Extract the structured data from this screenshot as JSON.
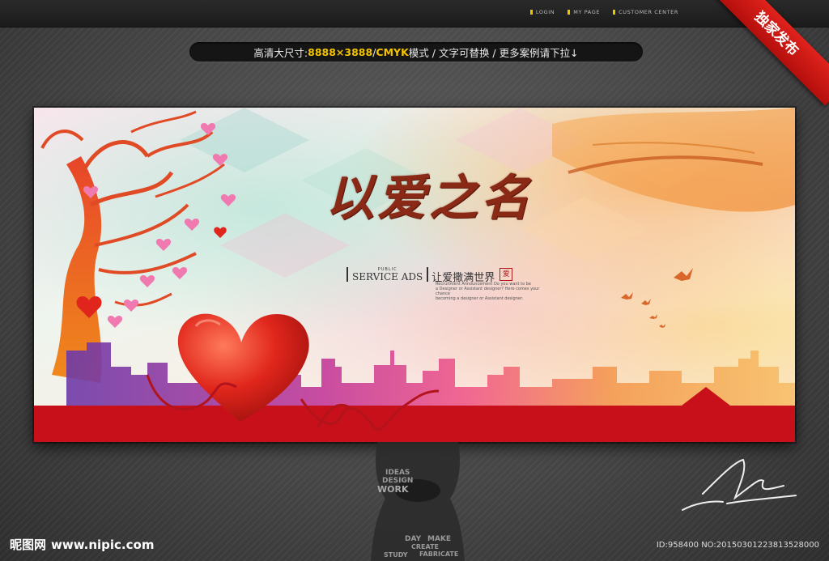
{
  "nav": {
    "items": [
      {
        "label": "LOGIN"
      },
      {
        "label": "MY PAGE"
      },
      {
        "label": "CUSTOMER CENTER"
      }
    ]
  },
  "ribbon": {
    "label": "独家发布"
  },
  "info_bar": {
    "part1": "高清大尺寸:",
    "size": "8888×3888",
    "sep1": " / ",
    "mode": "CMYK",
    "part2": "模式 / 文字可替换 / 更多案例请下拉↓"
  },
  "poster": {
    "title": "以爱之名",
    "public": "PUBLIC",
    "service_ads": "SERVICE ADS",
    "slogan": "让爱撒满世界",
    "seal": "爱",
    "desc_line1": "Recruitment Announcement Do you want to be",
    "desc_line2": "a Designer or Assistant designer? Here comes your chance",
    "desc_line3": "becoming a designer or Assistant designer."
  },
  "portrait_words": [
    "IDEAS",
    "DESIGN",
    "WORK",
    "DAY",
    "MAKE",
    "CREATE",
    "FABRICATE",
    "STUDY"
  ],
  "watermark": {
    "site_cn": "昵图网",
    "site_url": "www.nipic.com",
    "id_line": "ID:958400 NO:20150301223813528000"
  },
  "colors": {
    "accent_yellow": "#f4c400",
    "ribbon_red": "#d81e16",
    "heart_red": "#e0261c",
    "ground_red": "#c8101a"
  }
}
